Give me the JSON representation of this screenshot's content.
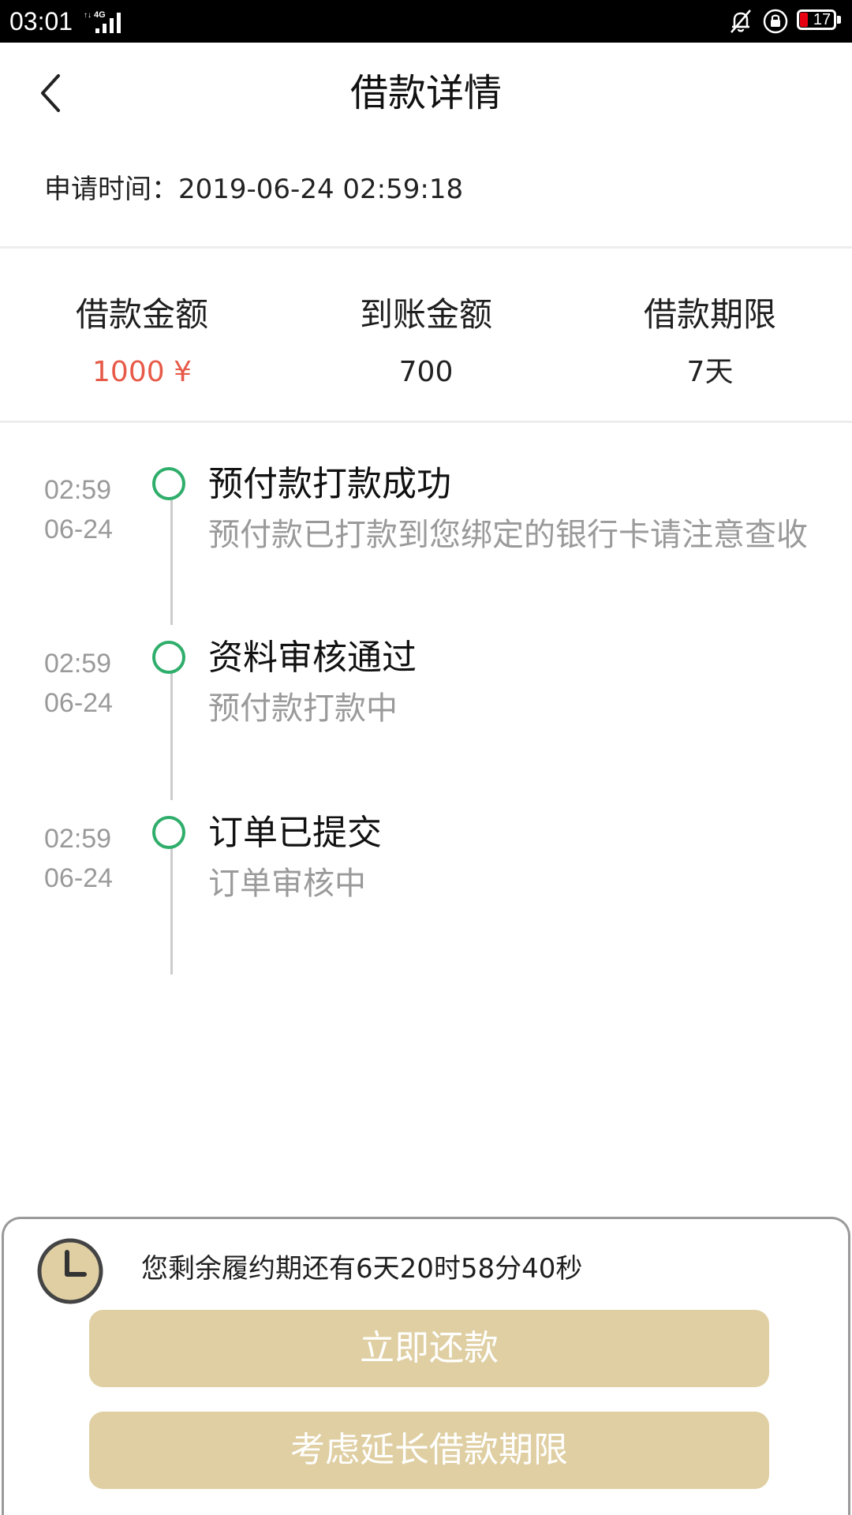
{
  "status_bar": {
    "time": "03:01",
    "network": "4G",
    "battery": "17",
    "icons": [
      "bell-off-icon",
      "rotation-lock-icon",
      "battery-icon"
    ]
  },
  "header": {
    "title": "借款详情",
    "back_icon": "chevron-left-icon"
  },
  "apply_time": "申请时间：2019-06-24 02:59:18",
  "summary": {
    "amount_label": "借款金额",
    "amount_value": "1000 ¥",
    "received_label": "到账金额",
    "received_value": "700",
    "term_label": "借款期限",
    "term_value": "7天"
  },
  "timeline": [
    {
      "time": "02:59",
      "date": "06-24",
      "title": "预付款打款成功",
      "desc": "预付款已打款到您绑定的银行卡请注意查收"
    },
    {
      "time": "02:59",
      "date": "06-24",
      "title": "资料审核通过",
      "desc": "预付款打款中"
    },
    {
      "time": "02:59",
      "date": "06-24",
      "title": "订单已提交",
      "desc": "订单审核中"
    }
  ],
  "bottom": {
    "countdown": "您剩余履约期还有6天20时58分40秒",
    "repay_button": "立即还款",
    "extend_button": "考虑延长借款期限",
    "clock_icon": "clock-icon"
  },
  "colors": {
    "accent_red": "#e75a48",
    "timeline_green": "#2fae6b",
    "button_gold": "#dfcfa3",
    "muted_text": "#9a9a9a"
  }
}
